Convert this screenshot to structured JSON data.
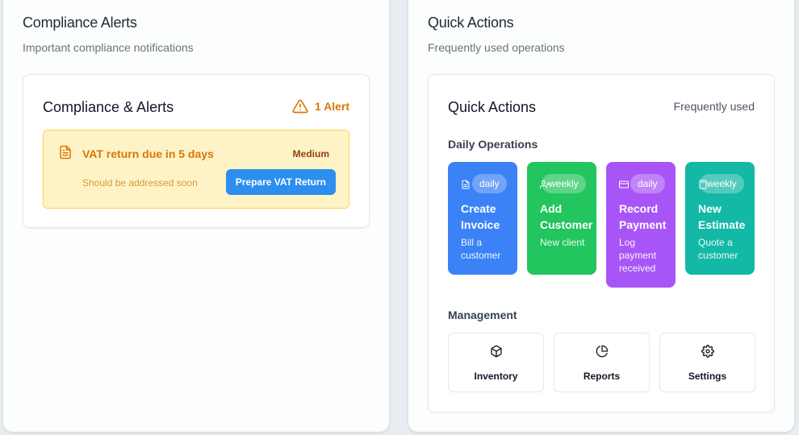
{
  "compliance": {
    "title": "Compliance Alerts",
    "subtitle": "Important compliance notifications",
    "card_title": "Compliance & Alerts",
    "alert_count": "1 Alert",
    "alert": {
      "title": "VAT return due in 5 days",
      "severity": "Medium",
      "description": "Should be addressed soon",
      "action_label": "Prepare VAT Return",
      "icon": "document-icon"
    }
  },
  "quick_actions": {
    "title": "Quick Actions",
    "subtitle": "Frequently used operations",
    "card_title": "Quick Actions",
    "card_subtitle": "Frequently used",
    "daily_label": "Daily Operations",
    "tiles": [
      {
        "title": "Create Invoice",
        "desc": "Bill a customer",
        "badge": "daily",
        "color": "#3b82f6",
        "icon": "document-icon"
      },
      {
        "title": "Add Customer",
        "desc": "New client",
        "badge": "weekly",
        "color": "#22c55e",
        "icon": "user-plus-icon"
      },
      {
        "title": "Record Payment",
        "desc": "Log payment received",
        "badge": "daily",
        "color": "#a855f7",
        "icon": "credit-card-icon"
      },
      {
        "title": "New Estimate",
        "desc": "Quote a customer",
        "badge": "weekly",
        "color": "#14b8a6",
        "icon": "calculator-icon"
      }
    ],
    "management_label": "Management",
    "management": [
      {
        "label": "Inventory",
        "icon": "box-icon"
      },
      {
        "label": "Reports",
        "icon": "pie-chart-icon"
      },
      {
        "label": "Settings",
        "icon": "gear-icon"
      }
    ]
  },
  "colors": {
    "warning": "#d97706",
    "warning_bg": "#fef3c7",
    "primary_button": "#2c8ff0"
  }
}
